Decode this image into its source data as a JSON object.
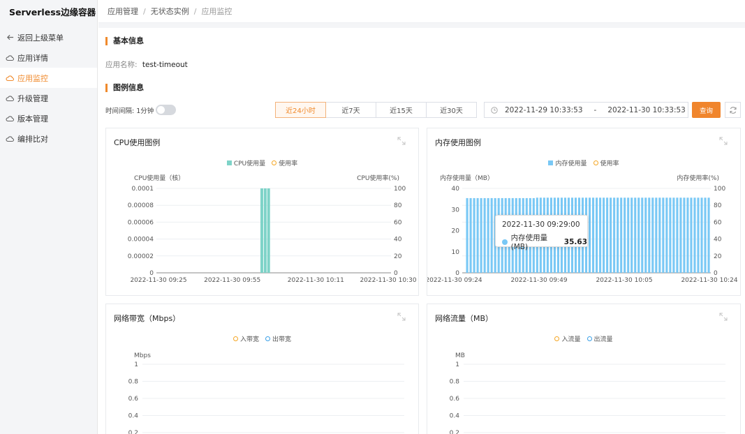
{
  "sidebar": {
    "brand": "Serverless边缘容器",
    "items": [
      {
        "label": "返回上级菜单",
        "icon": "arrow-left-icon"
      },
      {
        "label": "应用详情",
        "icon": "cloud-icon"
      },
      {
        "label": "应用监控",
        "icon": "cloud-icon",
        "active": true
      },
      {
        "label": "升级管理",
        "icon": "cloud-icon"
      },
      {
        "label": "版本管理",
        "icon": "cloud-icon"
      },
      {
        "label": "编排比对",
        "icon": "cloud-icon"
      }
    ]
  },
  "breadcrumb": [
    "应用管理",
    "无状态实例",
    "应用监控"
  ],
  "basic": {
    "title": "基本信息",
    "app_name_label": "应用名称:",
    "app_name": "test-timeout"
  },
  "chart_section": {
    "title": "图例信息",
    "interval_label": "时间间隔: 1分钟",
    "ranges": [
      "近24小时",
      "近7天",
      "近15天",
      "近30天"
    ],
    "active_range": "近24小时",
    "start": "2022-11-29 10:33:53",
    "dash": "-",
    "end": "2022-11-30 10:33:53",
    "query_label": "查询"
  },
  "colors": {
    "accent": "#f08a2c",
    "cpu_bar": "#7ed3c8",
    "mem_bar": "#79c8f5",
    "rate": "#f5a623",
    "net_out": "#3aa0e8"
  },
  "chart_data": [
    {
      "type": "bar",
      "title": "CPU使用图例",
      "legend": [
        "CPU使用量",
        "使用率"
      ],
      "ylabel_left": "CPU使用量（核）",
      "ylabel_right": "CPU使用率(%)",
      "ylim_left": [
        0,
        0.0001
      ],
      "ylim_right": [
        0,
        100
      ],
      "yticks_left": [
        "0",
        "0.00002",
        "0.00004",
        "0.00006",
        "0.00008",
        "0.0001"
      ],
      "yticks_right": [
        "0",
        "20",
        "40",
        "60",
        "80",
        "100"
      ],
      "xticks": [
        "2022-11-30 09:25",
        "2022-11-30 09:55",
        "2022-11-30 10:11",
        "2022-11-30 10:30"
      ],
      "x_range": [
        "2022-11-30 09:24",
        "2022-11-30 10:33"
      ],
      "bars": [
        {
          "x": "2022-11-30 09:55",
          "value": 0.0001
        },
        {
          "x": "2022-11-30 09:56",
          "value": 0.0001
        },
        {
          "x": "2022-11-30 09:57",
          "value": 0.0001
        }
      ]
    },
    {
      "type": "bar",
      "title": "内存使用图例",
      "legend": [
        "内存使用量",
        "使用率"
      ],
      "ylabel_left": "内存使用量（MB）",
      "ylabel_right": "内存使用率(%)",
      "ylim_left": [
        0,
        40
      ],
      "ylim_right": [
        0,
        100
      ],
      "yticks_left": [
        "0",
        "10",
        "20",
        "30",
        "40"
      ],
      "yticks_right": [
        "0",
        "20",
        "40",
        "60",
        "80",
        "100"
      ],
      "xticks": [
        "2022-11-30 09:24",
        "2022-11-30 09:49",
        "2022-11-30 10:05",
        "2022-11-30 10:24"
      ],
      "bar_count": 70,
      "values": [
        35.4,
        35.4,
        35.4,
        35.4,
        35.4,
        35.4,
        35.4,
        35.4,
        35.4,
        35.4,
        35.4,
        35.4,
        35.4,
        35.4,
        35.4,
        35.4,
        35.4,
        35.4,
        35.4,
        35.4,
        35.6,
        35.6,
        35.6,
        35.6,
        35.6,
        35.6,
        35.6,
        35.6,
        35.6,
        35.6,
        35.6,
        35.6,
        35.6,
        35.6,
        35.6,
        35.6,
        35.6,
        35.6,
        35.6,
        35.6,
        35.6,
        35.6,
        35.6,
        35.6,
        35.6,
        35.6,
        35.6,
        35.6,
        35.6,
        35.6,
        35.6,
        35.6,
        35.6,
        35.6,
        35.6,
        35.6,
        35.6,
        35.6,
        35.6,
        35.6,
        35.6,
        35.6,
        35.6,
        35.6,
        35.6,
        35.6,
        35.6,
        35.6,
        35.6,
        35.6
      ],
      "tooltip": {
        "time": "2022-11-30 09:29:00",
        "series": "内存使用量 (MB)",
        "value": "35.63"
      }
    },
    {
      "type": "line",
      "title": "网络带宽（Mbps）",
      "legend": [
        "入带宽",
        "出带宽"
      ],
      "ylabel": "Mbps",
      "yticks": [
        "0.2",
        "0.4",
        "0.6",
        "0.8",
        "1"
      ]
    },
    {
      "type": "line",
      "title": "网络流量（MB）",
      "legend": [
        "入流量",
        "出流量"
      ],
      "ylabel": "MB",
      "yticks": [
        "0.2",
        "0.4",
        "0.6",
        "0.8",
        "1"
      ]
    }
  ]
}
